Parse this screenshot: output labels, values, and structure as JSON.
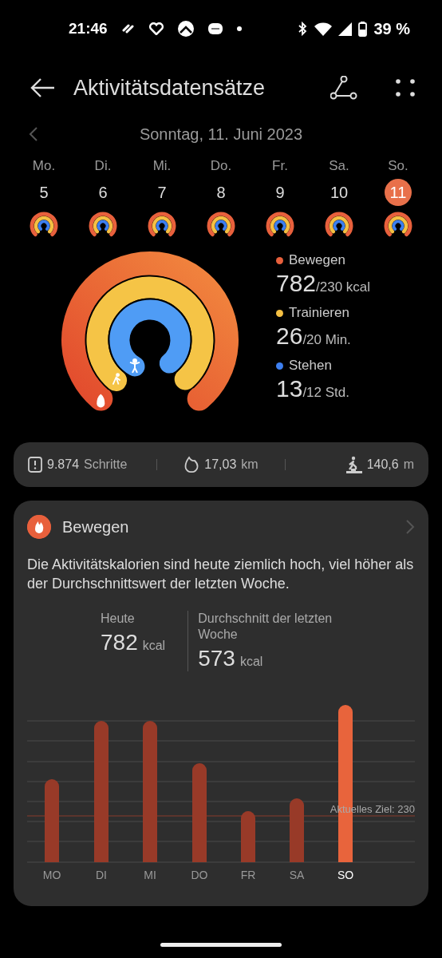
{
  "status_bar": {
    "time": "21:46",
    "battery": "39 %"
  },
  "header": {
    "title": "Aktivitätsdatensätze"
  },
  "date_nav": {
    "date": "Sonntag, 11. Juni 2023"
  },
  "week": [
    {
      "weekday": "Mo.",
      "day": "5",
      "selected": false
    },
    {
      "weekday": "Di.",
      "day": "6",
      "selected": false
    },
    {
      "weekday": "Mi.",
      "day": "7",
      "selected": false
    },
    {
      "weekday": "Do.",
      "day": "8",
      "selected": false
    },
    {
      "weekday": "Fr.",
      "day": "9",
      "selected": false
    },
    {
      "weekday": "Sa.",
      "day": "10",
      "selected": false
    },
    {
      "weekday": "So.",
      "day": "11",
      "selected": true
    }
  ],
  "legend": [
    {
      "name": "Bewegen",
      "color": "#e8603c",
      "value": "782",
      "goal": "/230 kcal"
    },
    {
      "name": "Trainieren",
      "color": "#f5c043",
      "value": "26",
      "goal": "/20 Min."
    },
    {
      "name": "Stehen",
      "color": "#3d7ff0",
      "value": "13",
      "goal": "/12 Std."
    }
  ],
  "stats": [
    {
      "kind": "steps",
      "value": "9.874",
      "unit": "Schritte"
    },
    {
      "kind": "distance",
      "value": "17,03",
      "unit": "km"
    },
    {
      "kind": "climb",
      "value": "140,6",
      "unit": "m"
    }
  ],
  "card": {
    "title": "Bewegen",
    "description": "Die Aktivitätskalorien sind heute ziemlich hoch, viel höher als der Durchschnittswert der letzten Woche.",
    "figures": [
      {
        "label": "Heute",
        "value": "782",
        "unit": "kcal"
      },
      {
        "label": "Durchschnitt der letzten Woche",
        "value": "573",
        "unit": "kcal"
      }
    ],
    "days": [
      {
        "label": "MO",
        "selected": false
      },
      {
        "label": "DI",
        "selected": false
      },
      {
        "label": "MI",
        "selected": false
      },
      {
        "label": "DO",
        "selected": false
      },
      {
        "label": "FR",
        "selected": false
      },
      {
        "label": "SA",
        "selected": false
      },
      {
        "label": "SO",
        "selected": true
      }
    ],
    "goal_label": "Aktuelles Ziel: 230"
  }
}
